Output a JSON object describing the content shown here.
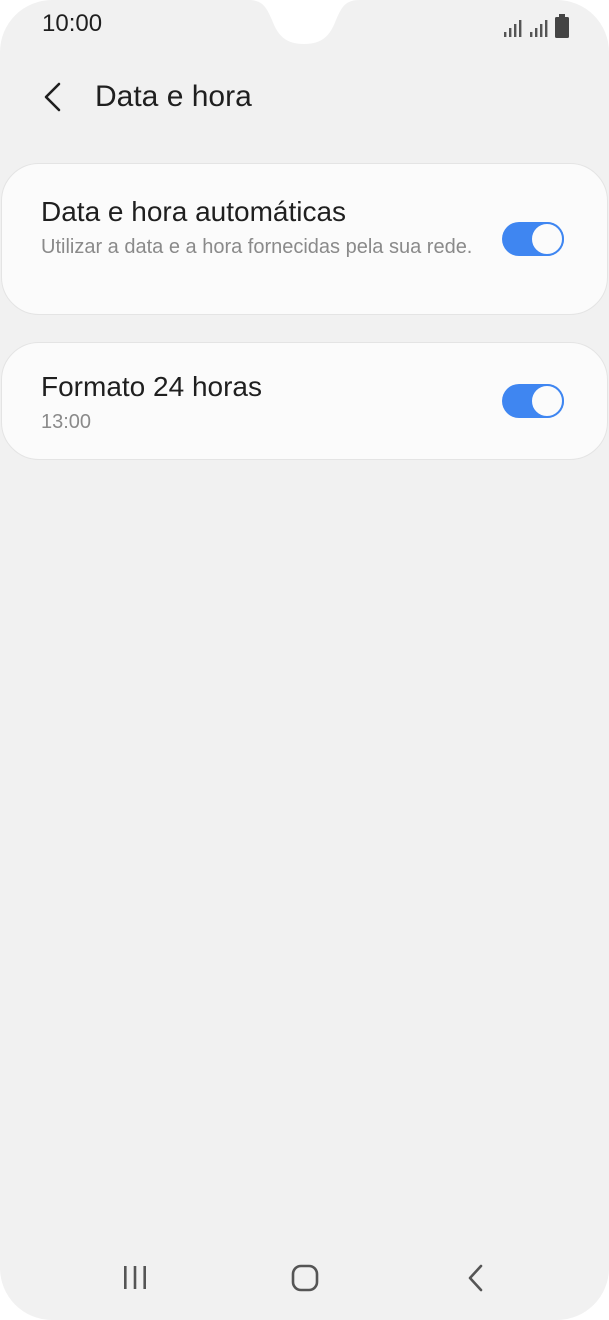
{
  "status_bar": {
    "time": "10:00",
    "icons": [
      "signal-icon",
      "signal-icon",
      "battery-icon"
    ]
  },
  "header": {
    "back_icon": "chevron-left-icon",
    "title": "Data e hora"
  },
  "settings": [
    {
      "title": "Data e hora automáticas",
      "subtitle": "Utilizar a data e a hora fornecidas pela sua rede.",
      "enabled": true
    },
    {
      "title": "Formato 24 horas",
      "subtitle": "13:00",
      "enabled": true
    }
  ],
  "nav_bar": {
    "icons": [
      "recent-apps-icon",
      "home-icon",
      "back-icon"
    ]
  },
  "colors": {
    "accent": "#3f86f1",
    "background": "#f1f1f1",
    "card": "#fbfbfb"
  }
}
